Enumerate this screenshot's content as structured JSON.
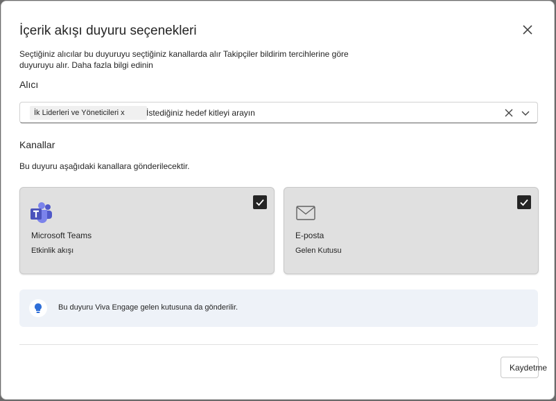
{
  "dialog": {
    "title": "İçerik akışı duyuru seçenekleri",
    "description": "Seçtiğiniz alıcılar bu duyuruyu seçtiğiniz kanallarda alır Takipçiler bildirim tercihlerine göre duyuruyu alır.",
    "learn_more": "Daha fazla bilgi edinin",
    "close_icon": "close-icon"
  },
  "recipient": {
    "label": "Alıcı",
    "chip": "İk Liderleri ve Yöneticileri x",
    "placeholder": "İstediğiniz hedef kitleyi arayın"
  },
  "channels": {
    "label": "Kanallar",
    "description": "Bu duyuru aşağıdaki kanallara gönderilecektir.",
    "items": [
      {
        "name": "Microsoft Teams",
        "sub": "Etkinlik akışı",
        "checked": true,
        "icon": "teams-icon"
      },
      {
        "name": "E-posta",
        "sub": "Gelen Kutusu",
        "checked": true,
        "icon": "mail-icon"
      }
    ]
  },
  "info": {
    "text": "Bu duyuru Viva Engage gelen kutusuna da gönderilir.",
    "icon": "lightbulb-icon",
    "accent": "#2f6fd8"
  },
  "footer": {
    "save_label": "Kaydetme"
  }
}
